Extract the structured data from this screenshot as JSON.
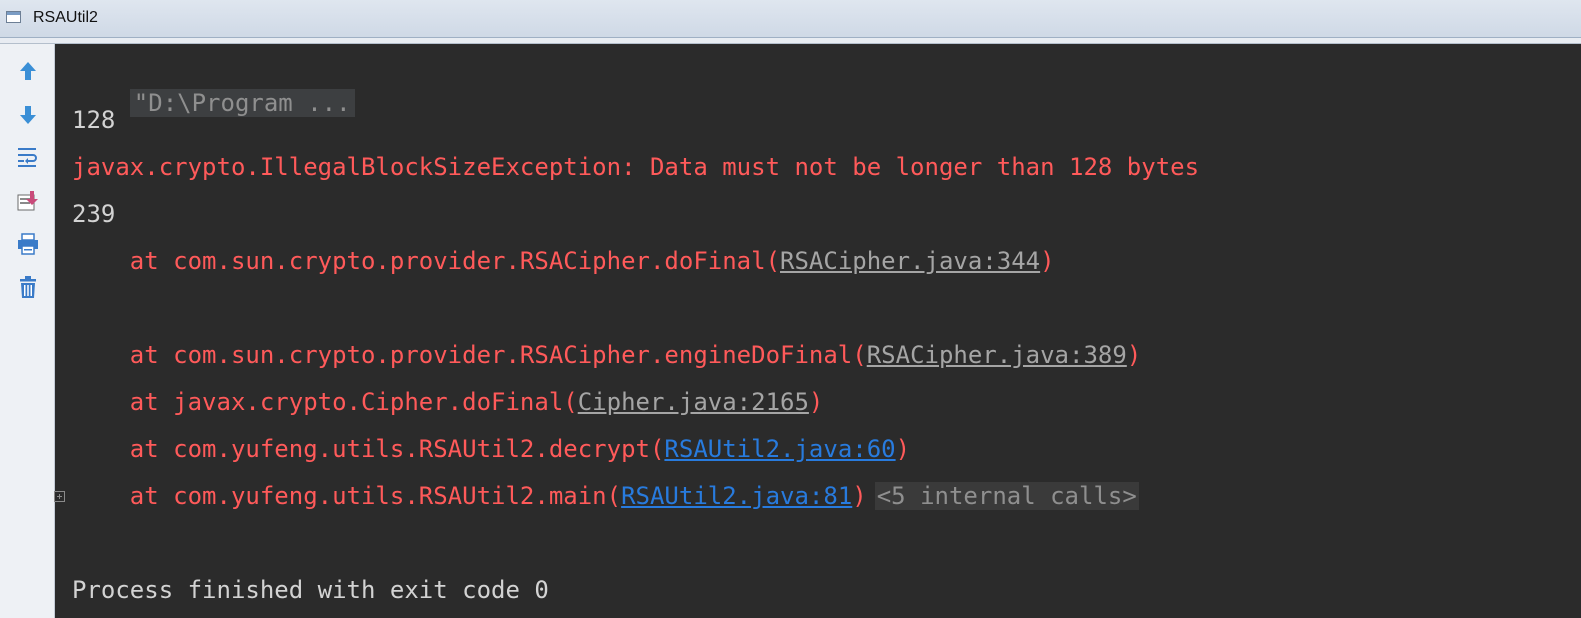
{
  "window": {
    "title": "RSAUtil2"
  },
  "toolbar": {
    "items": [
      {
        "name": "scroll-up-icon"
      },
      {
        "name": "scroll-down-icon"
      },
      {
        "name": "soft-wrap-icon"
      },
      {
        "name": "scroll-to-end-icon"
      },
      {
        "name": "print-icon"
      },
      {
        "name": "clear-all-icon"
      }
    ]
  },
  "colors": {
    "background": "#2b2b2b",
    "stdout": "#d3d3d3",
    "stderr": "#ff5a5a",
    "link": "#287bde"
  },
  "console": {
    "cmd": "\"D:\\Program ...",
    "out1": "128",
    "exception": "javax.crypto.IllegalBlockSizeException: Data must not be longer than 128 bytes",
    "out2": "239",
    "st1": {
      "prefix": "    at com.sun.crypto.provider.RSACipher.doFinal(",
      "link": "RSACipher.java:344",
      "suffix": ")"
    },
    "st2": {
      "prefix": "    at com.sun.crypto.provider.RSACipher.engineDoFinal(",
      "link": "RSACipher.java:389",
      "suffix": ")"
    },
    "st3": {
      "prefix": "    at javax.crypto.Cipher.doFinal(",
      "link": "Cipher.java:2165",
      "suffix": ")"
    },
    "st4": {
      "prefix": "    at com.yufeng.utils.RSAUtil2.decrypt(",
      "link": "RSAUtil2.java:60",
      "suffix": ")"
    },
    "st5": {
      "prefix": "    at com.yufeng.utils.RSAUtil2.main(",
      "link": "RSAUtil2.java:81",
      "suffix": ")",
      "internal": "<5 internal calls>"
    },
    "finish": "Process finished with exit code 0"
  }
}
